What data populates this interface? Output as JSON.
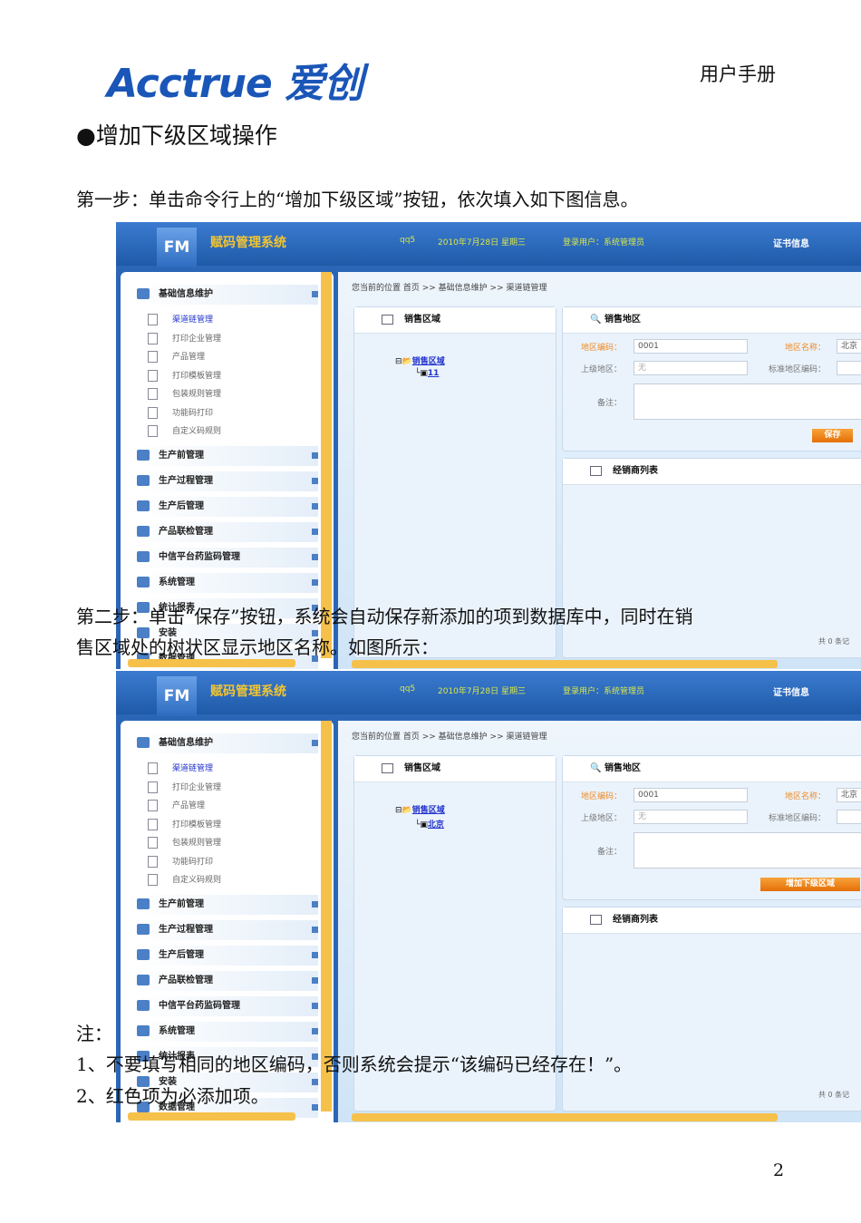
{
  "header": {
    "logo": "Acctrue 爱创",
    "doc_title": "用户手册"
  },
  "section_heading": "●增加下级区域操作",
  "step1": "第一步：单击命令行上的“增加下级区域”按钮，依次填入如下图信息。",
  "step2_line1": "第二步：单击“保存”按钮，系统会自动保存新添加的项到数据库中，同时在销",
  "step2_line2": "售区域处的树状区显示地区名称。如图所示：",
  "notes": {
    "title": "注：",
    "item1": "1、不要填写相同的地区编码，否则系统会提示“该编码已经存在！”。",
    "item2": "2、红色项为必添加项。"
  },
  "page_number": "2",
  "app": {
    "fm": "FM",
    "system_name": "赋码管理系统",
    "user_host": "qq5",
    "date": "2010年7月28日 星期三",
    "login_user": "登录用户：系统管理员",
    "cert": "证书信息",
    "breadcrumb": "您当前的位置 首页 >> 基础信息维护 >> 渠道链管理",
    "sidebar": {
      "group1": "基础信息维护",
      "subitems": [
        "渠道链管理",
        "打印企业管理",
        "产品管理",
        "打印模板管理",
        "包装规则管理",
        "功能码打印",
        "自定义码规则"
      ],
      "groups": [
        "生产前管理",
        "生产过程管理",
        "生产后管理",
        "产品联检管理",
        "中信平台药监码管理",
        "系统管理",
        "统计报表",
        "安装",
        "数据管理"
      ]
    },
    "tree_panel_title": "销售区域",
    "form_panel_title": "销售地区",
    "list_panel_title": "经销商列表",
    "labels": {
      "code": "地区编码：",
      "name": "地区名称：",
      "parent": "上级地区：",
      "std_code": "标准地区编码：",
      "remark": "备注："
    },
    "list_count": "共 0 条记"
  },
  "screenshots": [
    {
      "tree_root": "销售区域",
      "tree_child": "11",
      "code_value": "0001",
      "name_value": "北京",
      "parent_value": "无",
      "button": "保存"
    },
    {
      "tree_root": "销售区域",
      "tree_child": "北京",
      "code_value": "0001",
      "name_value": "北京",
      "parent_value": "无",
      "button": "增加下级区域"
    }
  ],
  "colors": {
    "brand": "#1a56b8",
    "header": "#2a66b5",
    "accent": "#f6c14a",
    "required": "#ef8a22"
  }
}
